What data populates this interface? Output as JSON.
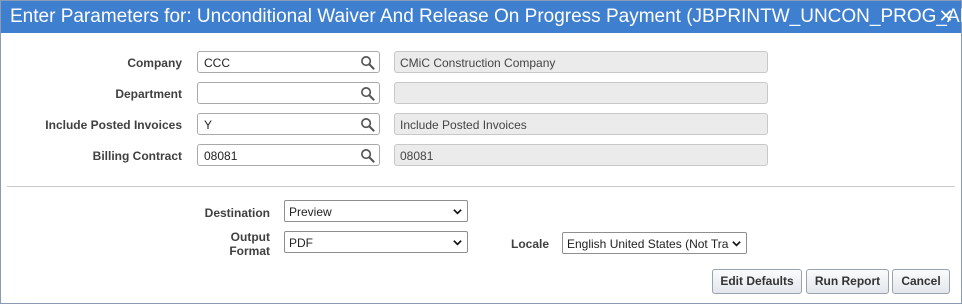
{
  "dialog": {
    "title": "Enter Parameters for: Unconditional Waiver And Release On Progress Payment (JBPRINTW_UNCON_PROG_AR)",
    "close_glyph": "✕"
  },
  "params": [
    {
      "label": "Company",
      "value": "CCC",
      "description": "CMiC Construction Company"
    },
    {
      "label": "Department",
      "value": "",
      "description": ""
    },
    {
      "label": "Include Posted Invoices",
      "value": "Y",
      "description": "Include Posted Invoices"
    },
    {
      "label": "Billing Contract",
      "value": "08081",
      "description": "08081"
    }
  ],
  "output": {
    "destination_label": "Destination",
    "destination_value": "Preview",
    "format_label_line1": "Output",
    "format_label_line2": "Format",
    "format_value": "PDF",
    "locale_label": "Locale",
    "locale_value": "English United States (Not Tra"
  },
  "buttons": {
    "edit_defaults": "Edit Defaults",
    "run_report": "Run Report",
    "cancel": "Cancel"
  },
  "icons": {
    "search": "search-icon",
    "close": "close-icon",
    "dropdown": "chevron-down-icon"
  },
  "colors": {
    "titlebar": "#3f7fcf",
    "readonly_bg": "#ebebeb"
  }
}
